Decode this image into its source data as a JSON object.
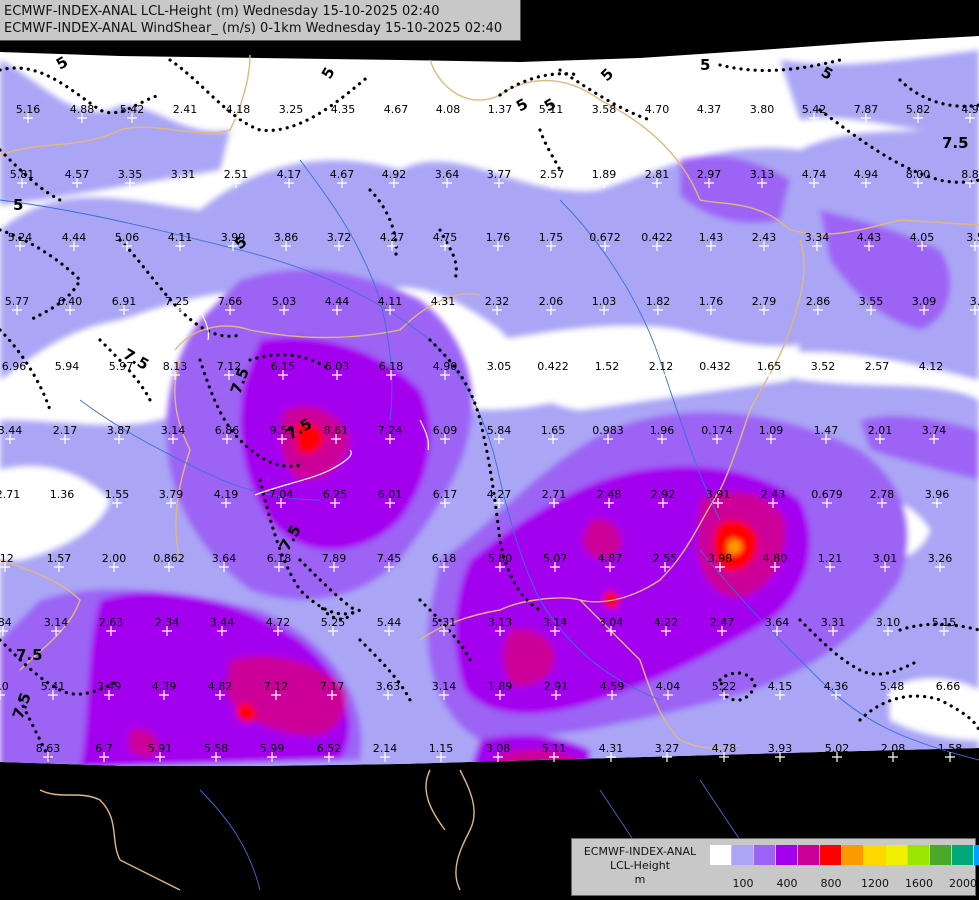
{
  "header": {
    "line1": "ECMWF-INDEX-ANAL LCL-Height (m) Wednesday 15-10-2025 02:40",
    "line2": "ECMWF-INDEX-ANAL WindShear_ (m/s) 0-1km Wednesday 15-10-2025 02:40"
  },
  "legend": {
    "title_lines": [
      "ECMWF-INDEX-ANAL",
      "LCL-Height",
      "m"
    ],
    "colors": [
      "#ffffff",
      "#aaa6f5",
      "#9c63f5",
      "#a400f0",
      "#cc0099",
      "#ff0000",
      "#ff9900",
      "#ffd700",
      "#f0f000",
      "#99e600",
      "#4aa82a",
      "#00a87a",
      "#00a0ff"
    ],
    "ticks": [
      "100",
      "400",
      "800",
      "1200",
      "1600",
      "2000"
    ]
  },
  "map": {
    "variable": "LCL-Height",
    "unit": "m",
    "overlay": "WindShear_ 0-1km (m/s)",
    "contour_labels": [
      "5",
      "5",
      "5",
      "5",
      "5",
      "5",
      "5",
      "5",
      "5",
      "7.5",
      "7.5",
      "7.5",
      "7.5",
      "7.5",
      "7.5",
      "7.5"
    ],
    "station_values": [
      "5.16",
      "4.88",
      "5.42",
      "2.41",
      "4.18",
      "3.25",
      "4.35",
      "4.67",
      "4.08",
      "1.37",
      "5.11",
      "3.58",
      "4.70",
      "4.37",
      "3.80",
      "5.42",
      "7.87",
      "5.82",
      "4.9",
      "5.81",
      "4.57",
      "3.35",
      "3.31",
      "2.51",
      "4.17",
      "4.67",
      "4.92",
      "3.64",
      "3.77",
      "2.57",
      "1.89",
      "2.81",
      "2.97",
      "3.13",
      "4.74",
      "4.94",
      "8.00",
      "8.8",
      "5.24",
      "4.44",
      "5.06",
      "4.11",
      "3.99",
      "3.86",
      "3.72",
      "4.27",
      "4.75",
      "1.76",
      "1.75",
      "0.672",
      "0.422",
      "1.43",
      "2.43",
      "3.34",
      "4.43",
      "4.05",
      "3.5",
      "5.77",
      "6.40",
      "6.91",
      "7.25",
      "7.66",
      "5.03",
      "4.44",
      "4.11",
      "4.31",
      "2.32",
      "2.06",
      "1.03",
      "1.82",
      "1.76",
      "2.79",
      "2.86",
      "3.55",
      "3.09",
      "3.",
      "6.96",
      "5.94",
      "5.97",
      "8.13",
      "7.12",
      "6.15",
      "6.03",
      "6.18",
      "4.90",
      "3.05",
      "0.422",
      "1.52",
      "2.12",
      "0.432",
      "1.65",
      "3.52",
      "2.57",
      "4.12",
      "3.44",
      "2.17",
      "3.87",
      "3.14",
      "6.86",
      "9.59",
      "8.61",
      "7.24",
      "6.09",
      "5.84",
      "1.65",
      "0.983",
      "1.96",
      "0.174",
      "1.09",
      "1.47",
      "2.01",
      "3.74",
      "2.71",
      "1.36",
      "1.55",
      "3.79",
      "4.19",
      "7.04",
      "6.25",
      "6.01",
      "6.17",
      "4.27",
      "2.71",
      "2.48",
      "2.92",
      "3.91",
      "2.43",
      "0.679",
      "2.78",
      "3.96",
      ".12",
      "1.57",
      "2.00",
      "0.862",
      "3.64",
      "6.18",
      "7.89",
      "7.45",
      "6.18",
      "5.80",
      "5.07",
      "4.87",
      "2.55",
      "3.98",
      "4.80",
      "1.21",
      "3.01",
      "3.26",
      ".84",
      "3.14",
      "2.63",
      "2.34",
      "3.44",
      "4.72",
      "5.25",
      "5.44",
      "5.31",
      "3.13",
      "3.14",
      "3.04",
      "4.22",
      "2.47",
      "3.64",
      "3.31",
      "3.10",
      "5.15",
      "5.0",
      "5.41",
      "3.49",
      "4.39",
      "4.82",
      "7.12",
      "7.17",
      "3.63",
      "3.14",
      "1.89",
      "2.91",
      "4.59",
      "4.04",
      "5.22",
      "4.15",
      "4.36",
      "5.48",
      "6.66",
      "8.63",
      "6.7",
      "5.91",
      "5.58",
      "5.99",
      "6.52",
      "2.14",
      "1.15",
      "3.08",
      "5.11",
      "4.31",
      "3.27",
      "4.78",
      "3.93",
      "5.02",
      "2.08",
      "1.58"
    ]
  }
}
